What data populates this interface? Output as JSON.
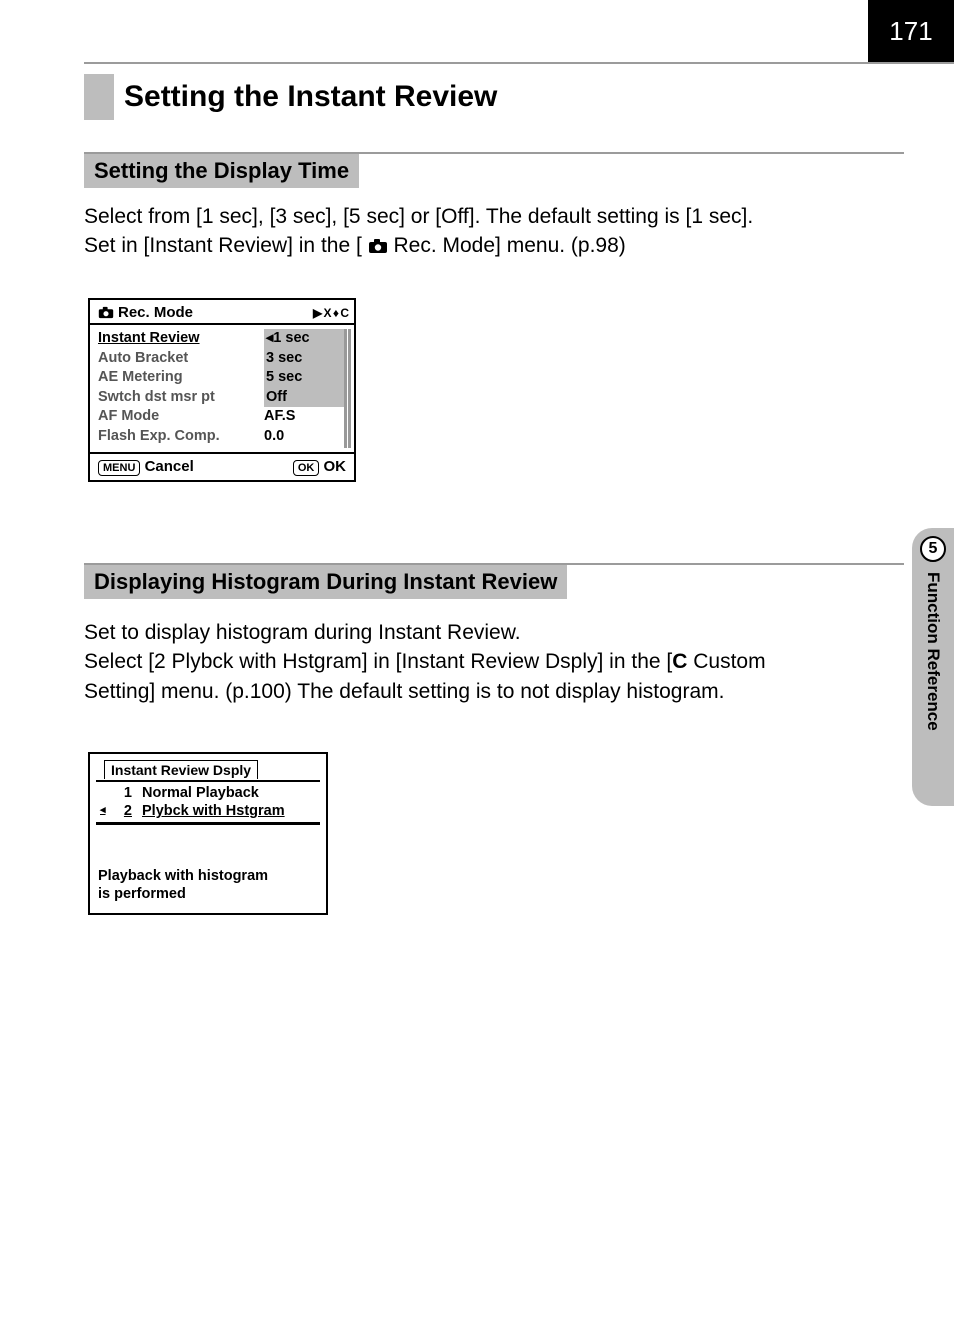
{
  "page_number": "171",
  "main_title": "Setting the Instant Review",
  "sections": {
    "display_time": {
      "heading": "Setting the Display Time",
      "para_l1": "Select from [1 sec], [3 sec], [5 sec] or [Off]. The default setting is [1 sec].",
      "para_l2_a": "Set in [Instant Review] in the [",
      "para_l2_b": " Rec. Mode] menu. (p.98)"
    },
    "histogram": {
      "heading": "Displaying Histogram During Instant Review",
      "para_l1": "Set to display histogram during Instant Review.",
      "para_l2_a": "Select [2 Plybck with Hstgram] in [Instant Review Dsply] in the [",
      "para_l2_b": " Custom",
      "para_l3": "Setting] menu. (p.100) The default setting is to not display histogram."
    }
  },
  "lcd1": {
    "title": "Rec. Mode",
    "tab_icons_text": "▶ X ♦ C",
    "rows": [
      {
        "label": "Instant Review",
        "value": "1 sec",
        "selected": true,
        "highlight": true,
        "caret": true
      },
      {
        "label": "Auto Bracket",
        "value": "3 sec",
        "selected": false,
        "highlight": true,
        "caret": false
      },
      {
        "label": "AE Metering",
        "value": "5 sec",
        "selected": false,
        "highlight": true,
        "caret": false
      },
      {
        "label": "Swtch dst msr pt",
        "value": "Off",
        "selected": false,
        "highlight": true,
        "caret": false
      },
      {
        "label": "AF Mode",
        "value": "AF.S",
        "selected": false,
        "highlight": false,
        "caret": false
      },
      {
        "label": "Flash Exp. Comp.",
        "value": "0.0",
        "selected": false,
        "highlight": false,
        "caret": false
      }
    ],
    "footer_left_pill": "MENU",
    "footer_left": "Cancel",
    "footer_right_pill": "OK",
    "footer_right": "OK"
  },
  "lcd2": {
    "tab": "Instant Review Dsply",
    "items": [
      {
        "num": "1",
        "label": "Normal Playback",
        "selected": false
      },
      {
        "num": "2",
        "label": "Plybck with Hstgram",
        "selected": true
      }
    ],
    "message_line1": "Playback with histogram",
    "message_line2": "is performed"
  },
  "side_tab": {
    "number": "5",
    "label": "Function Reference"
  },
  "custom_glyph": "C"
}
